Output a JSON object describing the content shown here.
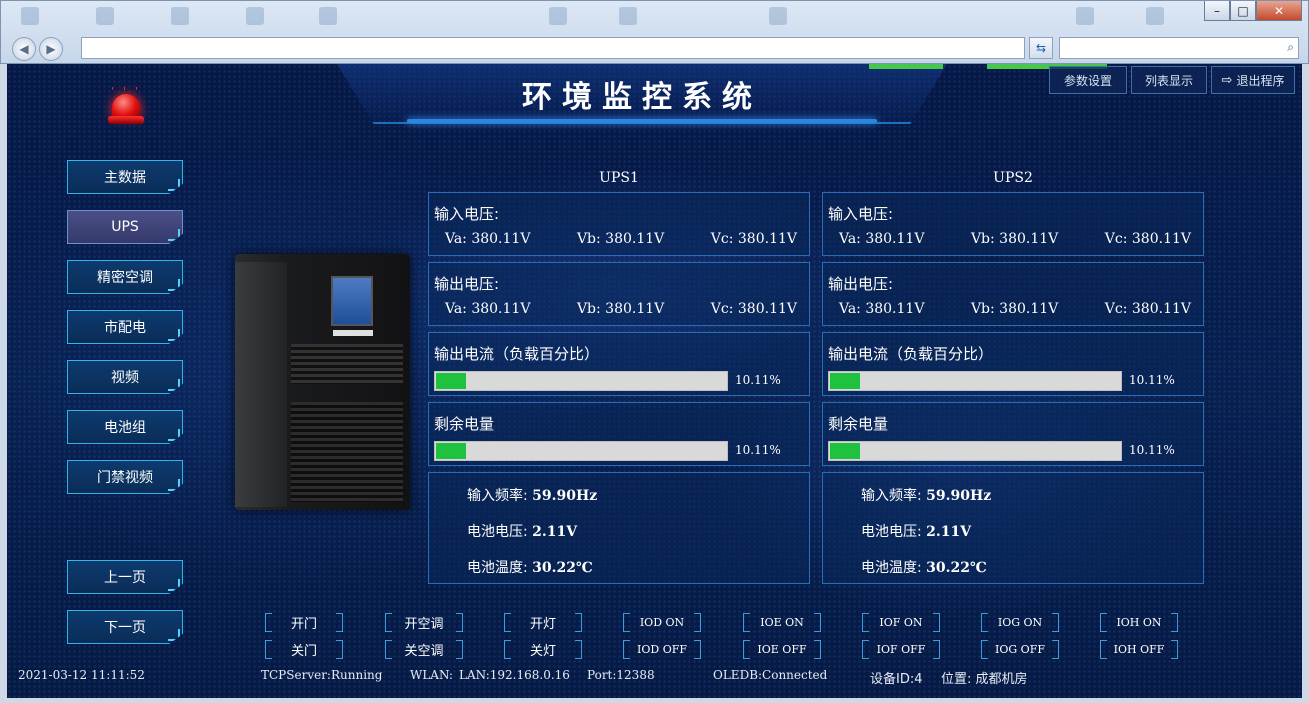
{
  "app": {
    "title": "环境监控系统",
    "top_buttons": [
      {
        "label": "参数设置",
        "icon": ""
      },
      {
        "label": "列表显示",
        "icon": ""
      },
      {
        "label": "退出程序",
        "icon": "exit-icon"
      }
    ]
  },
  "sidebar": {
    "items": [
      "主数据",
      "UPS",
      "精密空调",
      "市配电",
      "视频",
      "电池组",
      "门禁视频"
    ],
    "active": "UPS",
    "prev_page": "上一页",
    "next_page": "下一页"
  },
  "ups": [
    {
      "name": "UPS1",
      "input_voltage_label": "输入电压:",
      "input_voltage": {
        "va": "Va: 380.11V",
        "vb": "Vb: 380.11V",
        "vc": "Vc: 380.11V"
      },
      "output_voltage_label": "输出电压:",
      "output_voltage": {
        "va": "Va: 380.11V",
        "vb": "Vb: 380.11V",
        "vc": "Vc: 380.11V"
      },
      "output_current_label": "输出电流（负载百分比）",
      "output_current_pct": "10.11%",
      "output_current_fraction": 0.1011,
      "remaining_label": "剩余电量",
      "remaining_pct": "10.11%",
      "remaining_fraction": 0.1011,
      "freq_label": "输入频率:",
      "freq_value": "59.90Hz",
      "bat_voltage_label": "电池电压:",
      "bat_voltage_value": "2.11V",
      "bat_temp_label": "电池温度:",
      "bat_temp_value": "30.22℃"
    },
    {
      "name": "UPS2",
      "input_voltage_label": "输入电压:",
      "input_voltage": {
        "va": "Va: 380.11V",
        "vb": "Vb: 380.11V",
        "vc": "Vc: 380.11V"
      },
      "output_voltage_label": "输出电压:",
      "output_voltage": {
        "va": "Va: 380.11V",
        "vb": "Vb: 380.11V",
        "vc": "Vc: 380.11V"
      },
      "output_current_label": "输出电流（负载百分比）",
      "output_current_pct": "10.11%",
      "output_current_fraction": 0.1011,
      "remaining_label": "剩余电量",
      "remaining_pct": "10.11%",
      "remaining_fraction": 0.1011,
      "freq_label": "输入频率:",
      "freq_value": "59.90Hz",
      "bat_voltage_label": "电池电压:",
      "bat_voltage_value": "2.11V",
      "bat_temp_label": "电池温度:",
      "bat_temp_value": "30.22℃"
    }
  ],
  "controls": {
    "top_row": [
      "开门",
      "开空调",
      "开灯",
      "IOD ON",
      "IOE ON",
      "IOF ON",
      "IOG ON",
      "IOH ON"
    ],
    "bottom_row": [
      "关门",
      "关空调",
      "关灯",
      "IOD OFF",
      "IOE OFF",
      "IOF OFF",
      "IOG OFF",
      "IOH OFF"
    ]
  },
  "status": {
    "datetime": "2021-03-12 11:11:52",
    "tcp": "TCPServer:Running",
    "wlan": "WLAN:",
    "lan": "LAN:192.168.0.16",
    "port": "Port:12388",
    "oledb": "OLEDB:Connected",
    "device_id": "设备ID:4",
    "location": "位置: 成都机房"
  },
  "colors": {
    "bar_fill": "#1ec23e",
    "panel_border": "#2a6cb8",
    "nav_border": "#2fb4e8",
    "alarm": "#e01010"
  }
}
